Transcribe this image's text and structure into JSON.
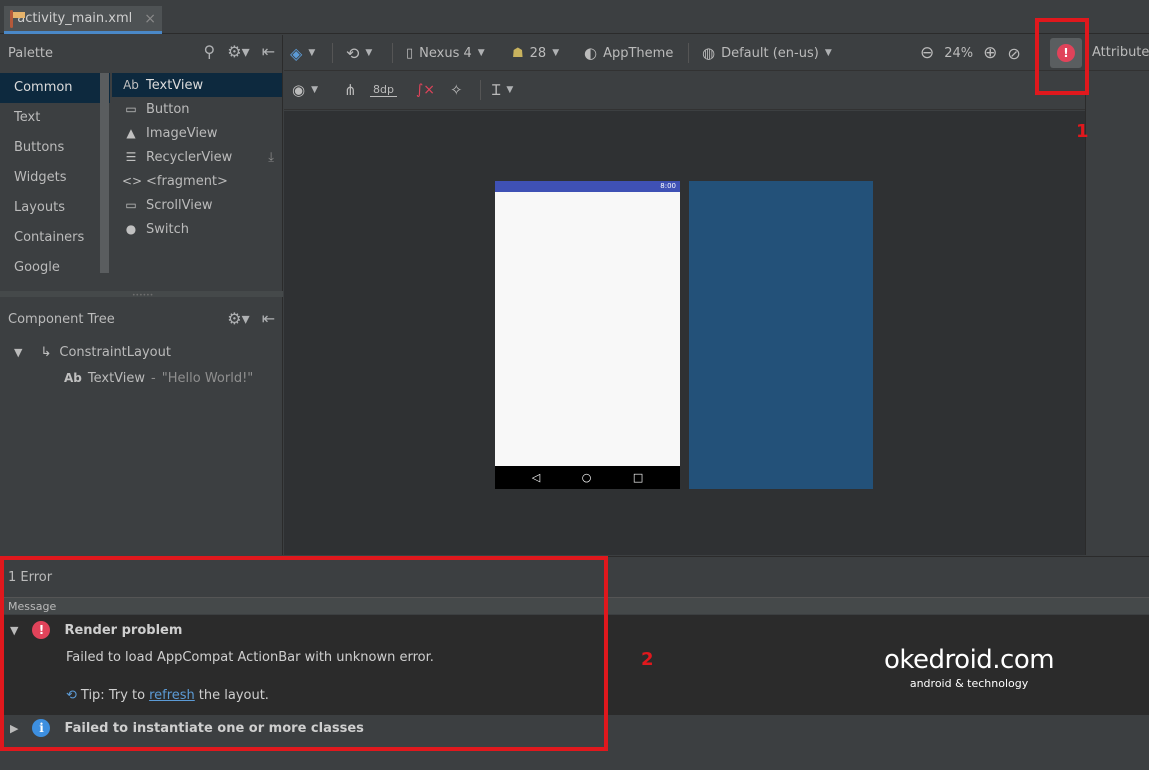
{
  "tab": {
    "filename": "activity_main.xml",
    "close": "×"
  },
  "palette": {
    "title": "Palette",
    "categories": [
      "Common",
      "Text",
      "Buttons",
      "Widgets",
      "Layouts",
      "Containers",
      "Google"
    ],
    "items": [
      {
        "icon": "Ab",
        "label": "TextView"
      },
      {
        "icon": "▭",
        "label": "Button"
      },
      {
        "icon": "▲",
        "label": "ImageView"
      },
      {
        "icon": "☰",
        "label": "RecyclerView"
      },
      {
        "icon": "<>",
        "label": "<fragment>"
      },
      {
        "icon": "▭",
        "label": "ScrollView"
      },
      {
        "icon": "●",
        "label": "Switch"
      }
    ]
  },
  "component_tree": {
    "title": "Component Tree",
    "root": "ConstraintLayout",
    "child_icon": "Ab",
    "child": "TextView",
    "child_sep": " - ",
    "child_text": "\"Hello World!\""
  },
  "toolbar": {
    "device": "Nexus 4",
    "api": "28",
    "theme": "AppTheme",
    "locale": "Default (en-us)",
    "zoom": "24%",
    "margin": "8dp",
    "attributes": "Attributes"
  },
  "phone": {
    "time": "8:00"
  },
  "errors": {
    "count": "1 Error",
    "header": "Message",
    "items": [
      {
        "title": "Render problem",
        "detail": "Failed to load AppCompat ActionBar with unknown error.",
        "tip_prefix": "Tip: Try to",
        "tip_link": "refresh",
        "tip_suffix": "the layout."
      },
      {
        "title": "Failed to instantiate one or more classes"
      }
    ]
  },
  "annotations": {
    "one": "1",
    "two": "2"
  },
  "watermark": {
    "brand": "okedroid.com",
    "tagline": "android & technology"
  }
}
